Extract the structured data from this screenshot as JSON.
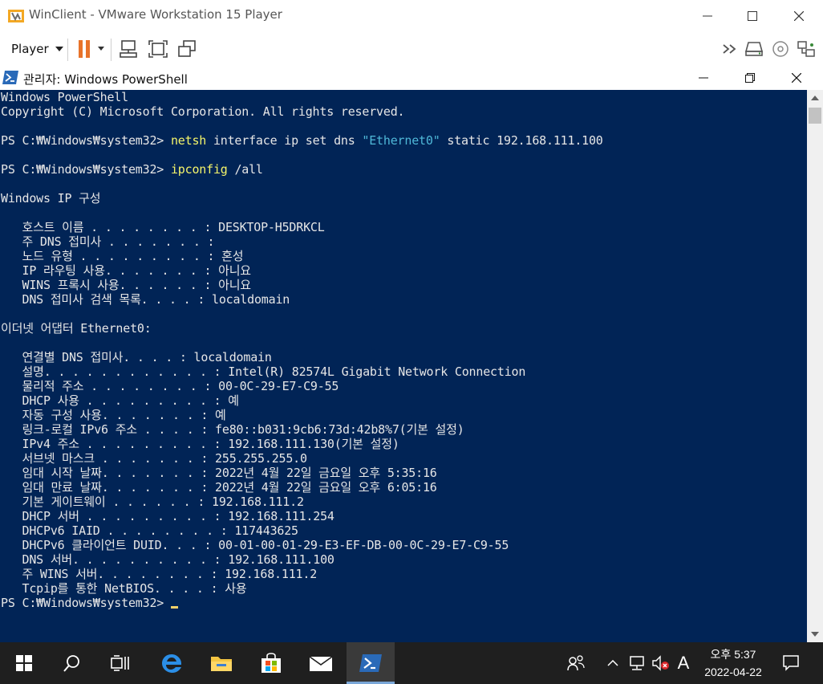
{
  "vmware": {
    "title": "WinClient - VMware Workstation 15 Player",
    "menu_label": "Player",
    "icons": [
      "pause-icon",
      "send-ctrl-alt-del-icon",
      "fit-guest-icon",
      "unity-icon",
      "forward-icon",
      "removable-devices-icon",
      "cd-icon",
      "network-icon"
    ]
  },
  "powershell": {
    "title": "관리자: Windows PowerShell",
    "lines": {
      "l01": "Windows PowerShell",
      "l02": "Copyright (C) Microsoft Corporation. All rights reserved.",
      "l03_prompt": "PS C:₩Windows₩system32> ",
      "l03_cmd": "netsh",
      "l03_args1": " interface ip set dns ",
      "l03_str": "\"Ethernet0\"",
      "l03_args2": " static 192.168.111.100",
      "l04_prompt": "PS C:₩Windows₩system32> ",
      "l04_cmd": "ipconfig",
      "l04_args": " /all",
      "l05": "Windows IP 구성",
      "l06": "   호스트 이름 . . . . . . . . : DESKTOP-H5DRKCL",
      "l07": "   주 DNS 접미사 . . . . . . . :",
      "l08": "   노드 유형 . . . . . . . . . : 혼성",
      "l09": "   IP 라우팅 사용. . . . . . . : 아니요",
      "l10": "   WINS 프록시 사용. . . . . . : 아니요",
      "l11": "   DNS 접미사 검색 목록. . . . : localdomain",
      "l12": "이더넷 어댑터 Ethernet0:",
      "l13": "   연결별 DNS 접미사. . . . : localdomain",
      "l14": "   설명. . . . . . . . . . . . : Intel(R) 82574L Gigabit Network Connection",
      "l15": "   물리적 주소 . . . . . . . . : 00-0C-29-E7-C9-55",
      "l16": "   DHCP 사용 . . . . . . . . . : 예",
      "l17": "   자동 구성 사용. . . . . . . : 예",
      "l18": "   링크-로컬 IPv6 주소 . . . . : fe80::b031:9cb6:73d:42b8%7(기본 설정)",
      "l19": "   IPv4 주소 . . . . . . . . . : 192.168.111.130(기본 설정)",
      "l20": "   서브넷 마스크 . . . . . . . : 255.255.255.0",
      "l21": "   임대 시작 날짜. . . . . . . : 2022년 4월 22일 금요일 오후 5:35:16",
      "l22": "   임대 만료 날짜. . . . . . . : 2022년 4월 22일 금요일 오후 6:05:16",
      "l23": "   기본 게이트웨이 . . . . . . : 192.168.111.2",
      "l24": "   DHCP 서버 . . . . . . . . . : 192.168.111.254",
      "l25": "   DHCPv6 IAID . . . . . . . . : 117443625",
      "l26": "   DHCPv6 클라이언트 DUID. . . : 00-01-00-01-29-E3-EF-DB-00-0C-29-E7-C9-55",
      "l27": "   DNS 서버. . . . . . . . . . : 192.168.111.100",
      "l28": "   주 WINS 서버. . . . . . . . : 192.168.111.2",
      "l29": "   Tcpip를 통한 NetBIOS. . . . : 사용",
      "l30_prompt": "PS C:₩Windows₩system32> "
    }
  },
  "taskbar": {
    "apps": [
      "start-icon",
      "search-icon",
      "task-view-icon",
      "edge-icon",
      "file-explorer-icon",
      "store-icon",
      "mail-icon",
      "powershell-icon"
    ],
    "tray_ime": "A",
    "clock_time": "오후 5:37",
    "clock_date": "2022-04-22"
  },
  "colors": {
    "console_bg": "#012456",
    "console_fg": "#e6e6e6",
    "command": "#f5f56a",
    "string": "#4fb8d8",
    "pause_orange": "#e8732a"
  }
}
